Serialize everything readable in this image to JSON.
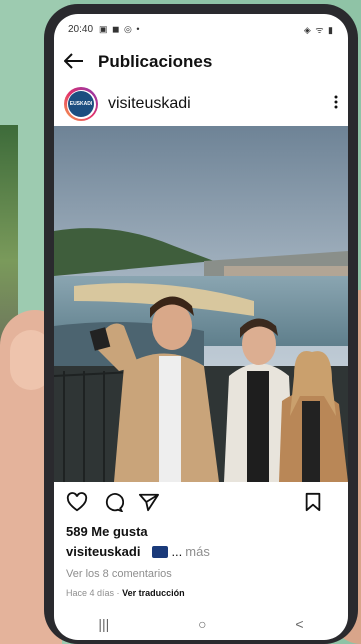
{
  "status_bar": {
    "time": "20:40",
    "notif_icons": "▣ ◼ ◎ •",
    "system_icons": "◈ ᯤ ▮"
  },
  "nav": {
    "back_icon": "arrow-left-icon",
    "title": "Publicaciones"
  },
  "post": {
    "account_logo_text": "EUSKADI",
    "username": "visiteuskadi",
    "likes": "589 Me gusta",
    "caption_user": "visiteuskadi",
    "caption_ellipsis": "...",
    "caption_more": "más",
    "comments_link": "Ver los 8 comentarios",
    "time_ago": "Hace 4 días",
    "separator": "·",
    "translate_link": "Ver traducción"
  },
  "system_nav": {
    "recent": "|||",
    "home": "○",
    "back": "<"
  },
  "colors": {
    "background": "#8fc3a6",
    "phone_frame": "#2a2a2e",
    "text": "#111111",
    "muted": "#8e8e8e"
  }
}
